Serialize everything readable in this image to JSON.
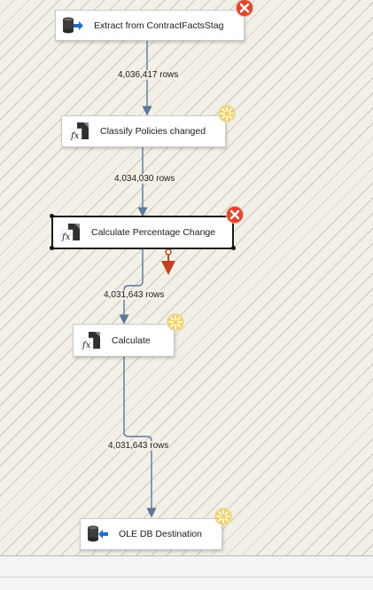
{
  "canvas": {
    "background": "#f3f0e8",
    "components": [
      {
        "id": "extract",
        "label": "Extract from ContractFactsStag",
        "icon": "ole-db-source-icon",
        "status": "error"
      },
      {
        "id": "classify",
        "label": "Classify Policies changed",
        "icon": "derived-column-icon",
        "status": "running"
      },
      {
        "id": "calcpct",
        "label": "Calculate Percentage Change",
        "icon": "derived-column-icon",
        "status": "error",
        "selected": true
      },
      {
        "id": "calc",
        "label": "Calculate",
        "icon": "derived-column-icon",
        "status": "running"
      },
      {
        "id": "dest",
        "label": "OLE DB Destination",
        "icon": "ole-db-destination-icon",
        "status": "running"
      }
    ],
    "paths": [
      {
        "from": "extract",
        "to": "classify",
        "rows": "4,036,417 rows"
      },
      {
        "from": "classify",
        "to": "calcpct",
        "rows": "4,034,030 rows"
      },
      {
        "from": "calcpct",
        "to": "calc",
        "rows": "4,031,643 rows"
      },
      {
        "from": "calc",
        "to": "dest",
        "rows": "4,031,643 rows"
      }
    ]
  },
  "colors": {
    "path_line": "#5d7898",
    "error_badge": "#e0462c",
    "running_badge": "#f2d268",
    "error_output_arrow": "#c2421b"
  }
}
